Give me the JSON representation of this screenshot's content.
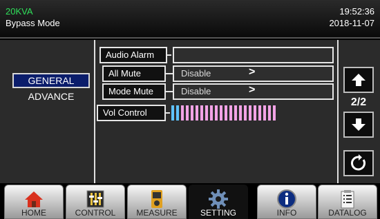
{
  "header": {
    "capacity": "20KVA",
    "mode": "Bypass Mode",
    "time": "19:52:36",
    "date": "2018-11-07"
  },
  "sidebar": {
    "items": [
      {
        "label": "GENERAL",
        "selected": true
      },
      {
        "label": "ADVANCE",
        "selected": false
      }
    ]
  },
  "settings": {
    "audio_alarm": {
      "label": "Audio Alarm"
    },
    "all_mute": {
      "label": "All Mute",
      "value": "Disable"
    },
    "mode_mute": {
      "label": "Mode Mute",
      "value": "Disable"
    },
    "vol_control": {
      "label": "Vol Control",
      "level_bars": 22,
      "bar_colors": [
        "#5fc3ff",
        "#f2a3e6"
      ]
    }
  },
  "pager": {
    "indicator": "2/2"
  },
  "tabs": [
    {
      "label": "HOME",
      "icon": "home-icon"
    },
    {
      "label": "CONTROL",
      "icon": "control-icon"
    },
    {
      "label": "MEASURE",
      "icon": "measure-icon"
    },
    {
      "label": "SETTING",
      "icon": "gear-icon",
      "active": true
    },
    {
      "label": "INFO",
      "icon": "info-icon"
    },
    {
      "label": "DATALOG",
      "icon": "datalog-icon"
    }
  ],
  "colors": {
    "selected_bg": "#0b1d6b",
    "status_green": "#2fe05a"
  }
}
